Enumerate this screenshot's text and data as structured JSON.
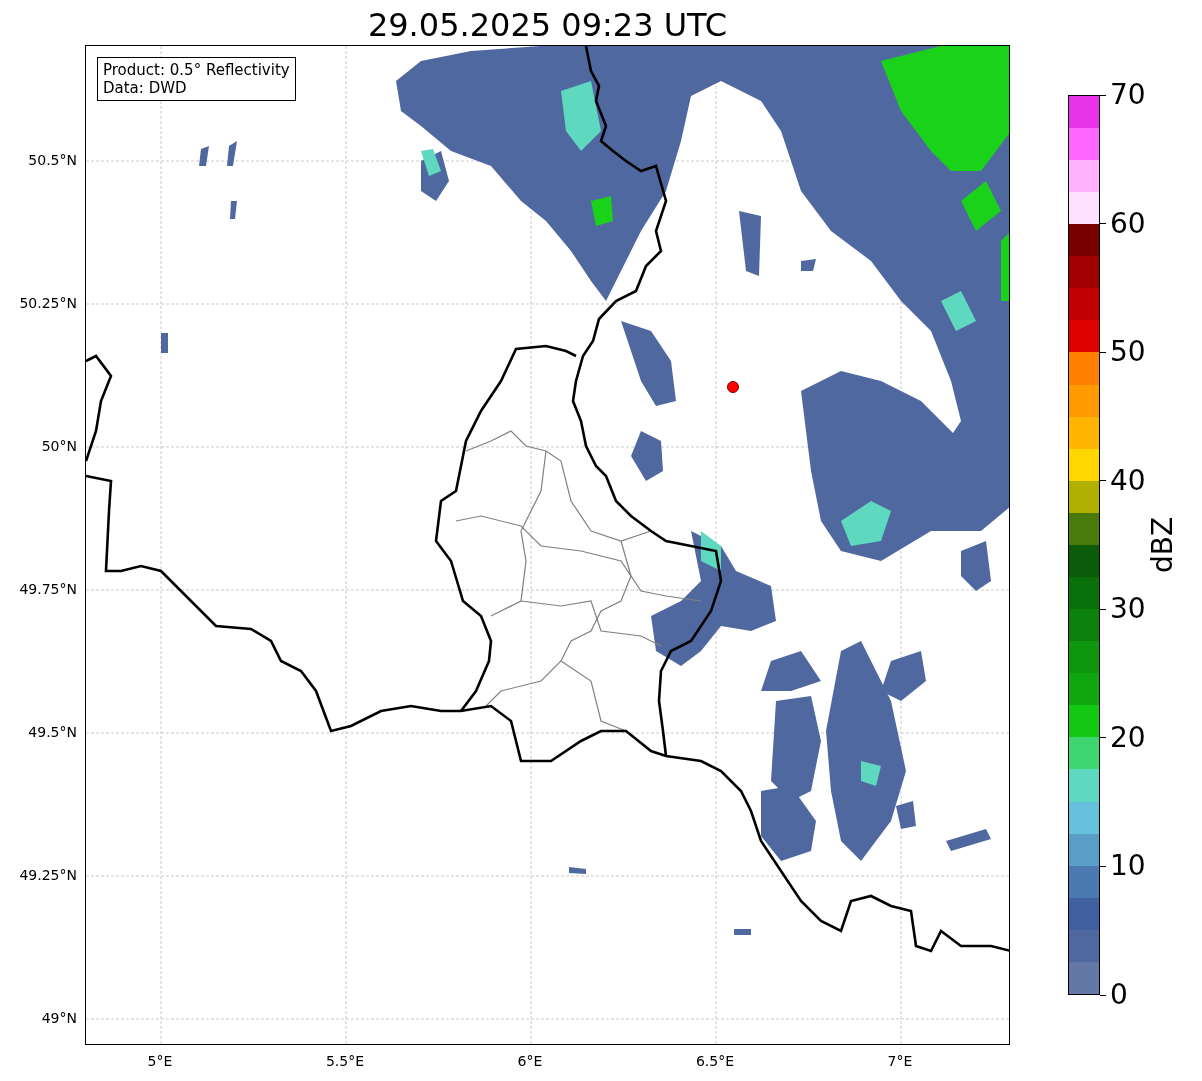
{
  "title": "29.05.2025 09:23 UTC",
  "annotation": [
    "Product: 0.5° Reflectivity",
    "Data: DWD"
  ],
  "latitude_labels": [
    "50.5°N",
    "50.25°N",
    "50°N",
    "49.75°N",
    "49.5°N",
    "49.25°N",
    "49°N"
  ],
  "longitude_labels": [
    "5°E",
    "5.5°E",
    "6°E",
    "6.5°E",
    "7°E"
  ],
  "colorbar": {
    "label": "dBZ",
    "ticks": [
      "70",
      "60",
      "50",
      "40",
      "30",
      "20",
      "10",
      "0"
    ],
    "bins": [
      {
        "color": "#6478a8"
      },
      {
        "color": "#5068a0"
      },
      {
        "color": "#4060a0"
      },
      {
        "color": "#4a7ab0"
      },
      {
        "color": "#5a9ec8"
      },
      {
        "color": "#65c0dc"
      },
      {
        "color": "#5fd8c0"
      },
      {
        "color": "#3dd670"
      },
      {
        "color": "#12c812"
      },
      {
        "color": "#10a610"
      },
      {
        "color": "#0e960e"
      },
      {
        "color": "#0c820c"
      },
      {
        "color": "#0a700a"
      },
      {
        "color": "#0a5c0a"
      },
      {
        "color": "#4a7a0a"
      },
      {
        "color": "#b0b000"
      },
      {
        "color": "#ffd700"
      },
      {
        "color": "#ffb400"
      },
      {
        "color": "#ff9a00"
      },
      {
        "color": "#ff7f00"
      },
      {
        "color": "#e00000"
      },
      {
        "color": "#c00000"
      },
      {
        "color": "#a00000"
      },
      {
        "color": "#7a0000"
      },
      {
        "color": "#ffe0ff"
      },
      {
        "color": "#ffb3ff"
      },
      {
        "color": "#ff66ff"
      },
      {
        "color": "#e833e8"
      }
    ]
  }
}
